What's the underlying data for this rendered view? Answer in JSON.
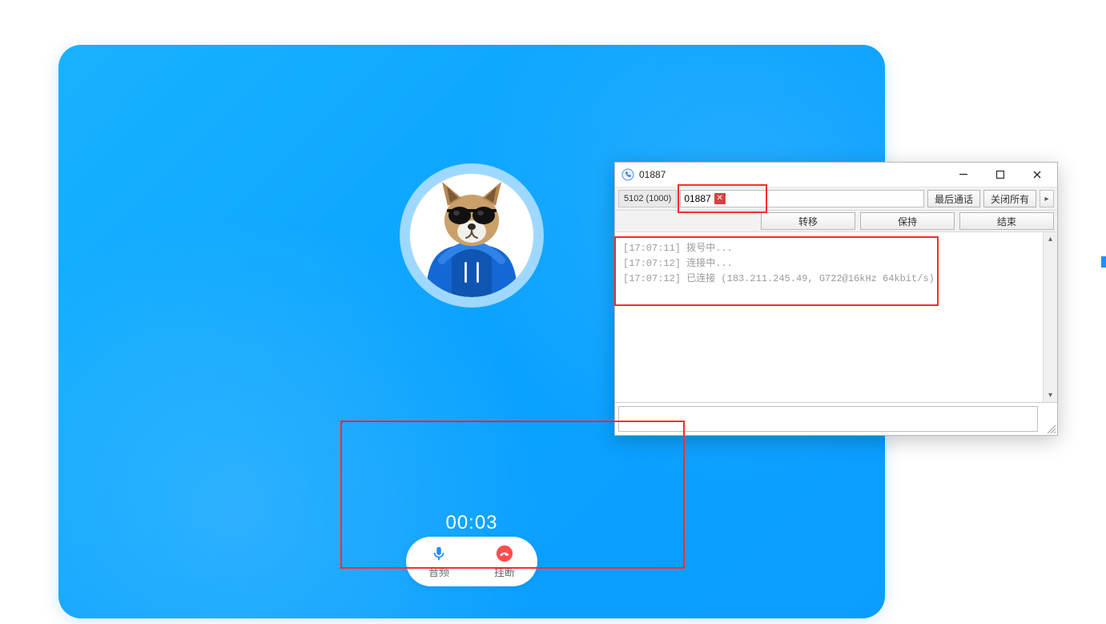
{
  "call": {
    "timer": "00:03",
    "audio_label": "音频",
    "hangup_label": "挂断"
  },
  "popup": {
    "title": "01887",
    "tab_label": "5102 (1000)",
    "number_value": "01887",
    "last_call_label": "最后通话",
    "close_all_label": "关闭所有",
    "transfer_label": "转移",
    "hold_label": "保持",
    "end_label": "结束",
    "log": [
      "[17:07:11] 拨号中...",
      "[17:07:12] 连接中...",
      "[17:07:12] 已连接 (183.211.245.49, G722@16kHz 64kbit/s)"
    ],
    "input_value": ""
  }
}
